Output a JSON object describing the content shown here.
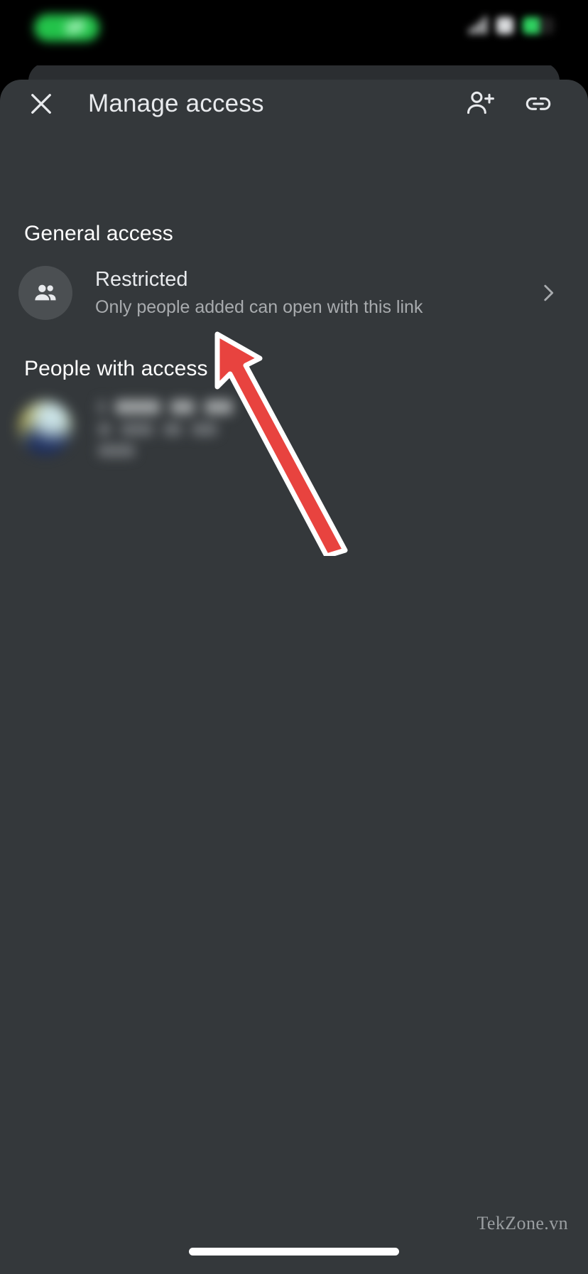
{
  "status_bar": {
    "left_pill": "camera-cutout-pill",
    "icons": [
      "signal-icon",
      "wifi-icon",
      "battery-icon"
    ]
  },
  "header": {
    "title": "Manage access",
    "close_icon": "close-icon",
    "add_person_icon": "person-add-icon",
    "link_icon": "link-icon"
  },
  "general_access": {
    "heading": "General access",
    "row": {
      "icon": "people-group-icon",
      "title": "Restricted",
      "subtitle": "Only people added can open with this link",
      "chevron_icon": "chevron-right-icon"
    }
  },
  "people_with_access": {
    "heading": "People with access",
    "people": [
      {
        "avatar": "user-avatar-blurred",
        "name": "(blurred)",
        "detail": "(blurred)"
      }
    ]
  },
  "annotation": {
    "type": "arrow",
    "points_to": "Restricted row",
    "color": "#e8433f",
    "outline_color": "#ffffff"
  },
  "watermark": {
    "text": "TekZone.vn"
  },
  "system_nav": {
    "home_indicator": "home-indicator"
  },
  "colors": {
    "sheet_bg": "#34383b",
    "sheet_back_bg": "#2b2e31",
    "status_bar_bg": "#000000",
    "primary_text": "#e8eaed",
    "secondary_text": "#a8abae",
    "avatar_bg": "#4b4f52",
    "accent_red": "#e8433f"
  }
}
